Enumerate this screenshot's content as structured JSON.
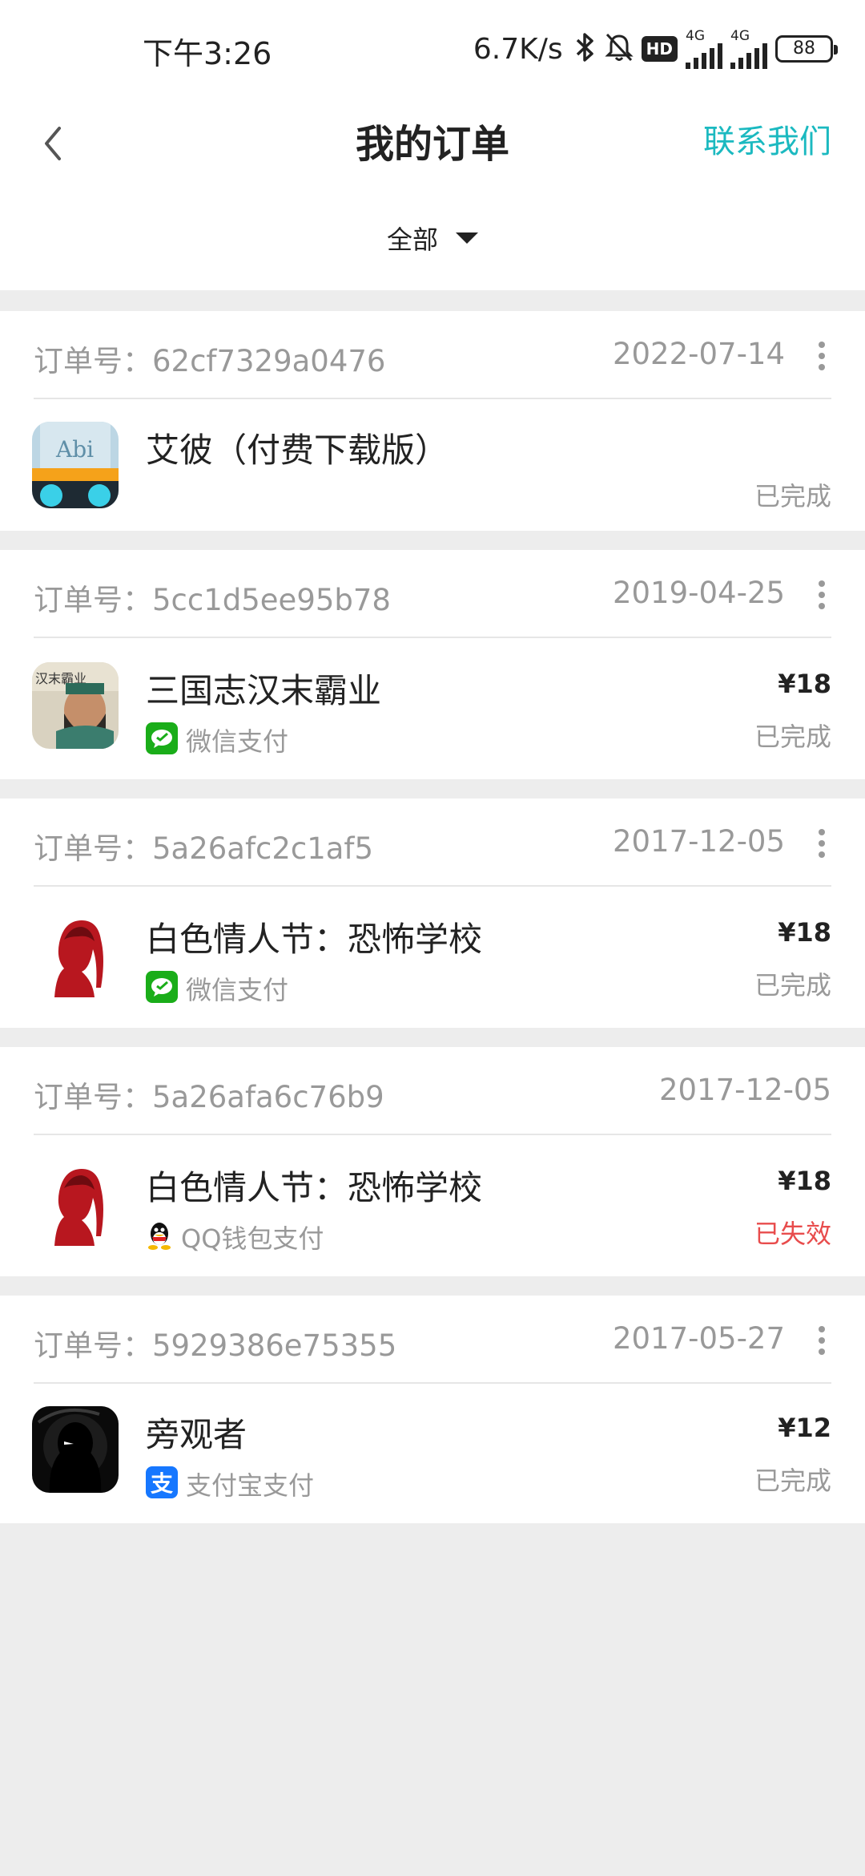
{
  "status_bar": {
    "time": "下午3:26",
    "speed": "6.7K/s",
    "hd_badge": "HD",
    "net1": "4G",
    "net2": "4G",
    "battery": "88"
  },
  "header": {
    "title": "我的订单",
    "contact": "联系我们"
  },
  "filter": {
    "label": "全部"
  },
  "orders": [
    {
      "order_no": "订单号：62cf7329a0476",
      "date": "2022-07-14",
      "app": "艾彼（付费下载版）",
      "price": "",
      "payment": "",
      "status": "已完成"
    },
    {
      "order_no": "订单号：5cc1d5ee95b78",
      "date": "2019-04-25",
      "app": "三国志汉末霸业",
      "price": "¥18",
      "payment": "微信支付",
      "status": "已完成"
    },
    {
      "order_no": "订单号：5a26afc2c1af5",
      "date": "2017-12-05",
      "app": "白色情人节：恐怖学校",
      "price": "¥18",
      "payment": "微信支付",
      "status": "已完成"
    },
    {
      "order_no": "订单号：5a26afa6c76b9",
      "date": "2017-12-05",
      "app": "白色情人节：恐怖学校",
      "price": "¥18",
      "payment": "QQ钱包支付",
      "status": "已失效"
    },
    {
      "order_no": "订单号：5929386e75355",
      "date": "2017-05-27",
      "app": "旁观者",
      "price": "¥12",
      "payment": "支付宝支付",
      "status": "已完成"
    }
  ],
  "colors": {
    "accent": "#1bb9c0",
    "failed": "#e84c4c",
    "wechat": "#1aad19",
    "alipay": "#1677ff"
  }
}
